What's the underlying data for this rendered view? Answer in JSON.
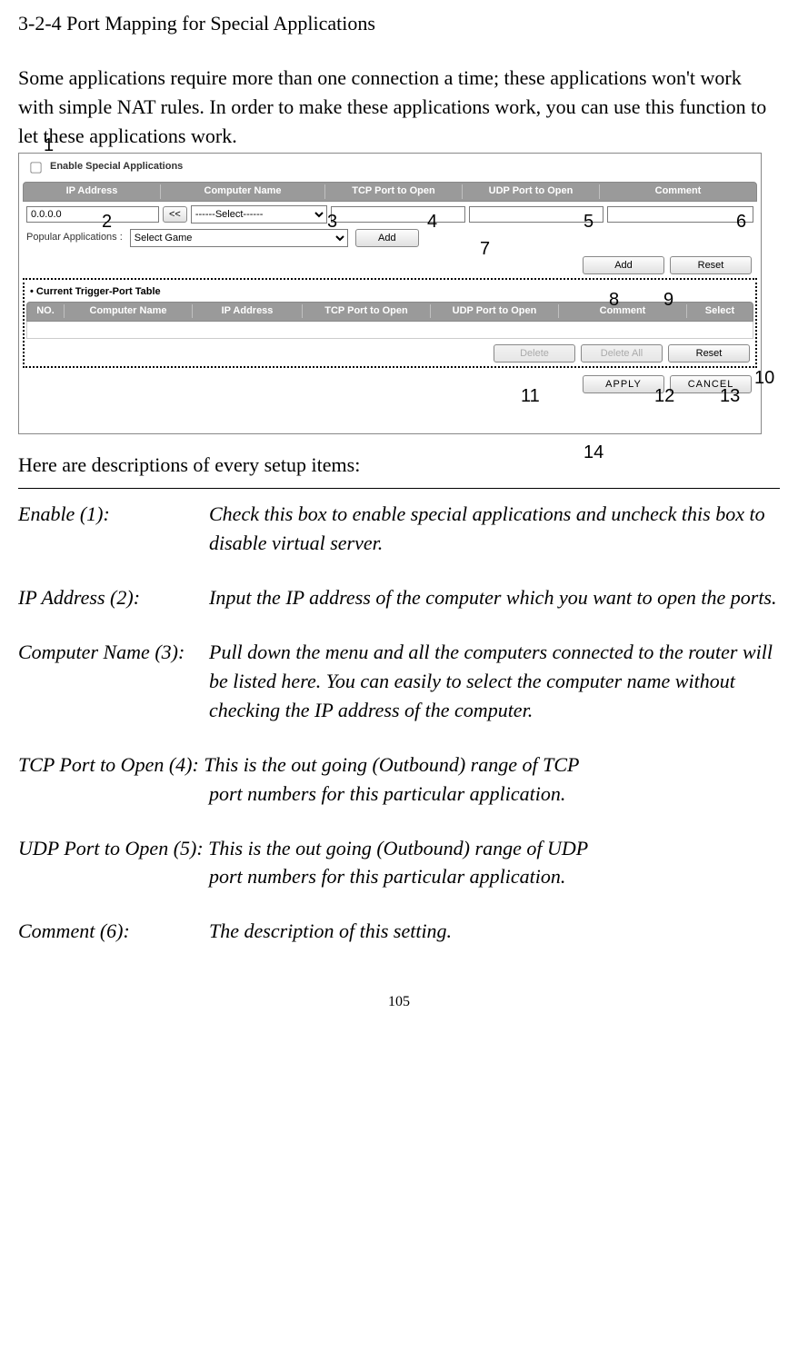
{
  "heading": "3-2-4 Port Mapping for Special Applications",
  "intro": "Some applications require more than one connection a time; these applications won't work with simple NAT rules. In order to make these applications work, you can use this function to let these applications work.",
  "ui": {
    "enable_label": "Enable Special Applications",
    "headers_top": [
      "IP Address",
      "Computer Name",
      "TCP Port to Open",
      "UDP Port to Open",
      "Comment"
    ],
    "ip_value": "0.0.0.0",
    "assign_btn": "<<",
    "computer_select": "------Select------",
    "popular_label": "Popular Applications  :",
    "popular_select": "Select Game",
    "popular_add": "Add",
    "add_btn": "Add",
    "reset_btn": "Reset",
    "trigger_title": "Current Trigger-Port Table",
    "headers_bottom": [
      "NO.",
      "Computer Name",
      "IP Address",
      "TCP Port to Open",
      "UDP Port to Open",
      "Comment",
      "Select"
    ],
    "delete_btn": "Delete",
    "delete_all_btn": "Delete All",
    "reset2_btn": "Reset",
    "apply_btn": "APPLY",
    "cancel_btn": "CANCEL"
  },
  "callouts": {
    "n1": "1",
    "n2": "2",
    "n3": "3",
    "n4": "4",
    "n5": "5",
    "n6": "6",
    "n7": "7",
    "n8": "8",
    "n9": "9",
    "n10": "10",
    "n11": "11",
    "n12": "12",
    "n13": "13",
    "n14": "14"
  },
  "desc_intro": "Here are descriptions of every setup items:",
  "items": {
    "enable_term": "Enable (1):",
    "enable_desc": "Check this box to enable special applications and uncheck this box to disable virtual server.",
    "ip_term": "IP Address (2):",
    "ip_desc": "Input the IP address of the computer which you want to open the ports.",
    "cn_term": "Computer Name (3):",
    "cn_desc": "Pull down the menu and all the computers connected to the router will be listed here. You can easily to select the computer name without checking the IP address of the computer.",
    "tcp_term": "TCP Port to Open (4): ",
    "tcp_desc_first": "This is the out going (Outbound) range of TCP",
    "tcp_desc_cont": "port numbers for this particular application.",
    "udp_term": "UDP Port to Open (5): ",
    "udp_desc_first": "This is the out going (Outbound) range of UDP",
    "udp_desc_cont": "port numbers for this particular application.",
    "comment_term": "Comment (6):",
    "comment_desc": "The description of this setting."
  },
  "page_number": "105"
}
